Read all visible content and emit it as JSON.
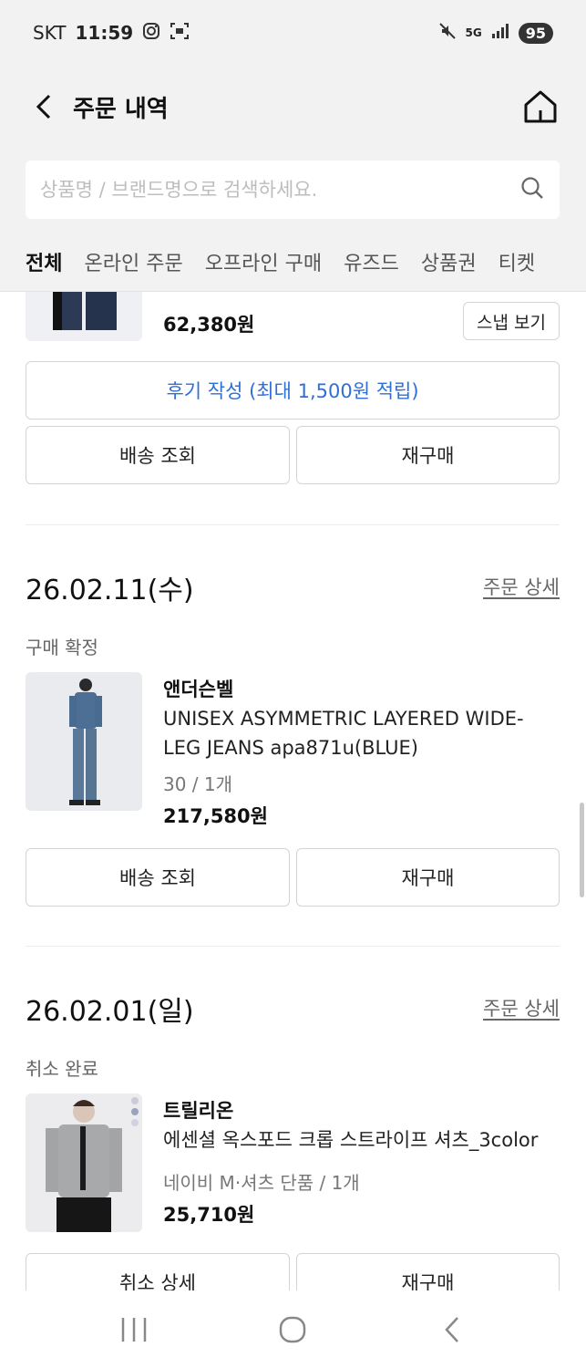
{
  "status_bar": {
    "carrier": "SKT",
    "time": "11:59",
    "battery": "95",
    "icons": [
      "instagram-icon",
      "screenshot-icon",
      "mute-icon",
      "5g-icon",
      "signal-icon"
    ]
  },
  "header": {
    "title": "주문 내역",
    "back_icon": "chevron-left-icon",
    "home_icon": "home-icon"
  },
  "search": {
    "placeholder": "상품명 / 브랜드명으로 검색하세요.",
    "value": "",
    "icon": "search-icon"
  },
  "tabs": [
    {
      "label": "전체",
      "active": true
    },
    {
      "label": "온라인 주문",
      "active": false
    },
    {
      "label": "오프라인 구매",
      "active": false
    },
    {
      "label": "유즈드",
      "active": false
    },
    {
      "label": "상품권",
      "active": false
    },
    {
      "label": "티켓",
      "active": false
    }
  ],
  "orders": [
    {
      "partial": true,
      "item": {
        "price": "62,380원",
        "snap_label": "스냅 보기"
      },
      "review_label": "후기 작성 (최대 1,500원 적립)",
      "actions": [
        "배송 조회",
        "재구매"
      ]
    },
    {
      "date": "26.02.11(수)",
      "detail_link": "주문 상세",
      "status": "구매 확정",
      "item": {
        "brand": "앤더슨벨",
        "name": "UNISEX ASYMMETRIC LAYERED WIDE-LEG JEANS apa871u(BLUE)",
        "option": "30 / 1개",
        "price": "217,580원"
      },
      "actions": [
        "배송 조회",
        "재구매"
      ]
    },
    {
      "date": "26.02.01(일)",
      "detail_link": "주문 상세",
      "status": "취소 완료",
      "item": {
        "brand": "트릴리온",
        "name": "에센셜 옥스포드 크롭 스트라이프 셔츠_3color",
        "option": "네이비 M·셔츠 단품 / 1개",
        "price": "25,710원"
      },
      "actions": [
        "취소 상세",
        "재구매"
      ]
    }
  ],
  "nav_bar": {
    "icons": [
      "recent-apps-icon",
      "home-circle-icon",
      "back-icon"
    ]
  },
  "colors": {
    "accent_link": "#2f6fd6",
    "header_bg": "#f2f2f2"
  }
}
